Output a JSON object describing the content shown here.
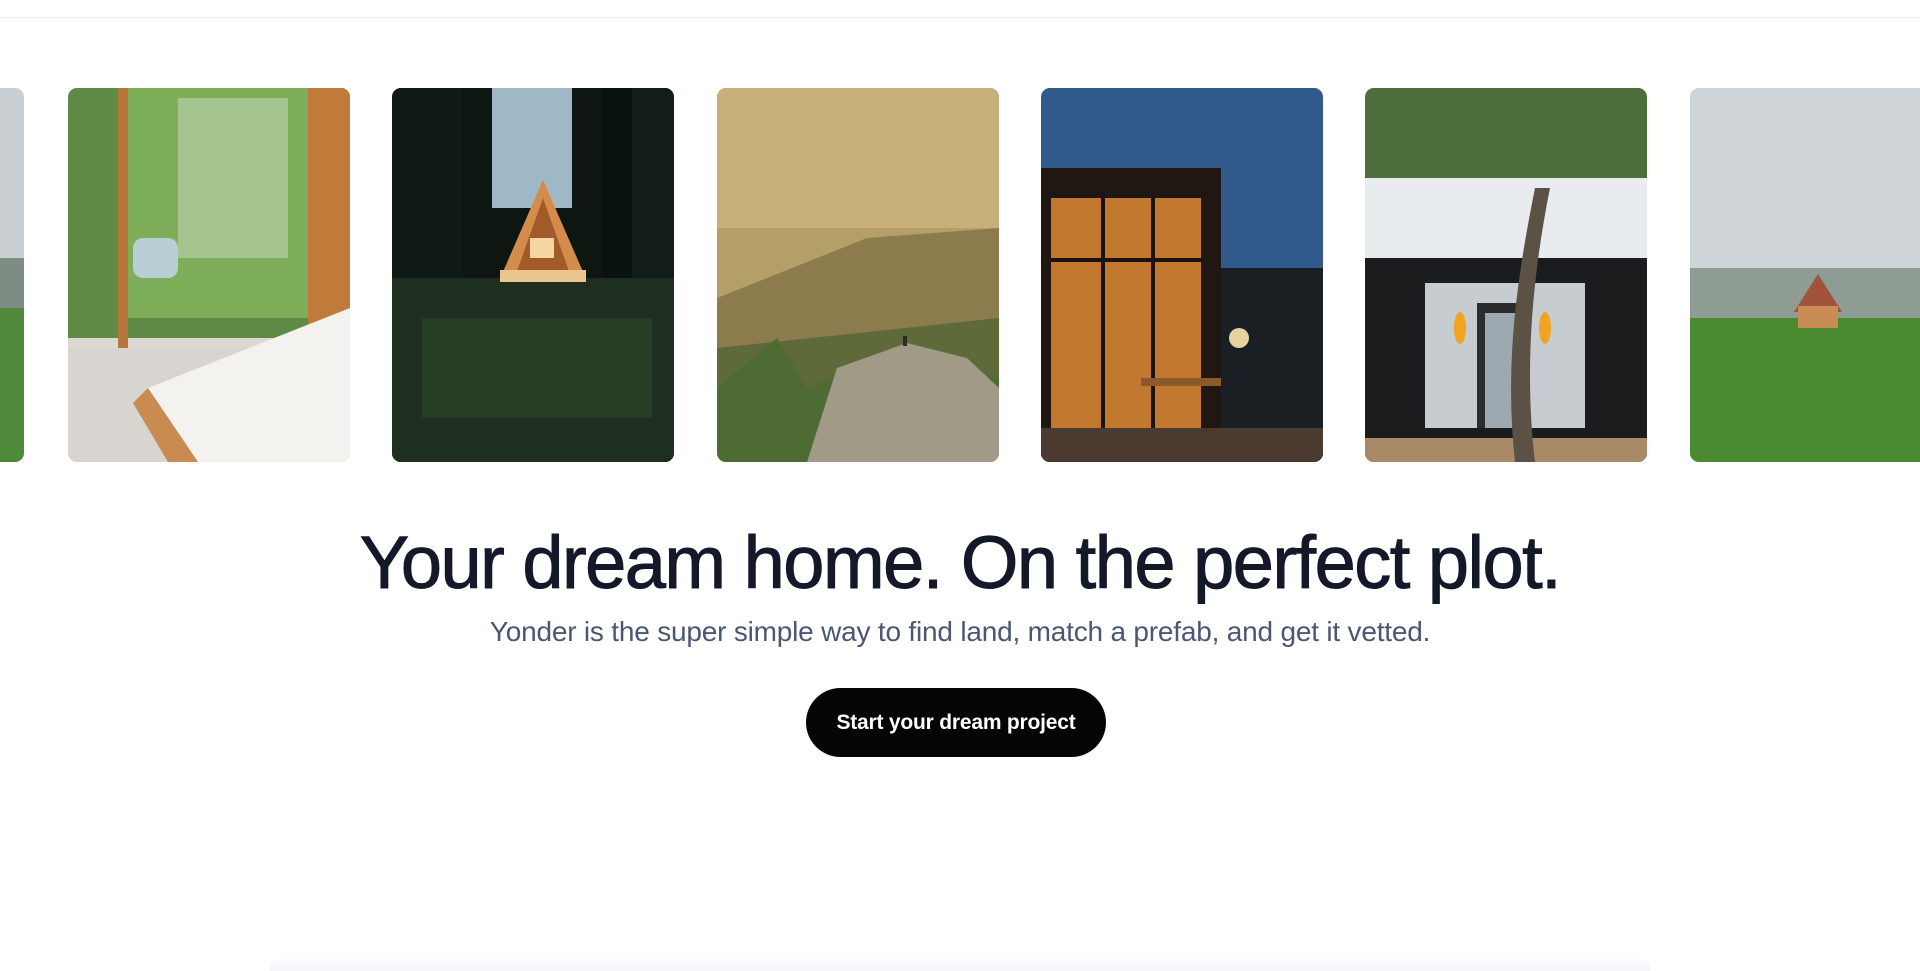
{
  "hero": {
    "title": "Your dream home. On the perfect plot.",
    "subtitle": "Yonder is the super simple way to find land, match a prefab, and get it vetted.",
    "cta_label": "Start your dream project"
  },
  "gallery": {
    "images": [
      {
        "subject": "cloudy-meadow-edge"
      },
      {
        "subject": "bedroom-sliding-door-forest"
      },
      {
        "subject": "a-frame-cabin-night-forest"
      },
      {
        "subject": "hiker-on-mountain-rock-sunset"
      },
      {
        "subject": "modern-cabin-dusk-person-laptop"
      },
      {
        "subject": "container-home-rooftop-deck"
      },
      {
        "subject": "a-frame-cabin-misty-meadow"
      }
    ]
  },
  "colors": {
    "title": "#151829",
    "subtitle": "#4b5673",
    "cta_background": "#050505",
    "cta_text": "#ffffff"
  }
}
